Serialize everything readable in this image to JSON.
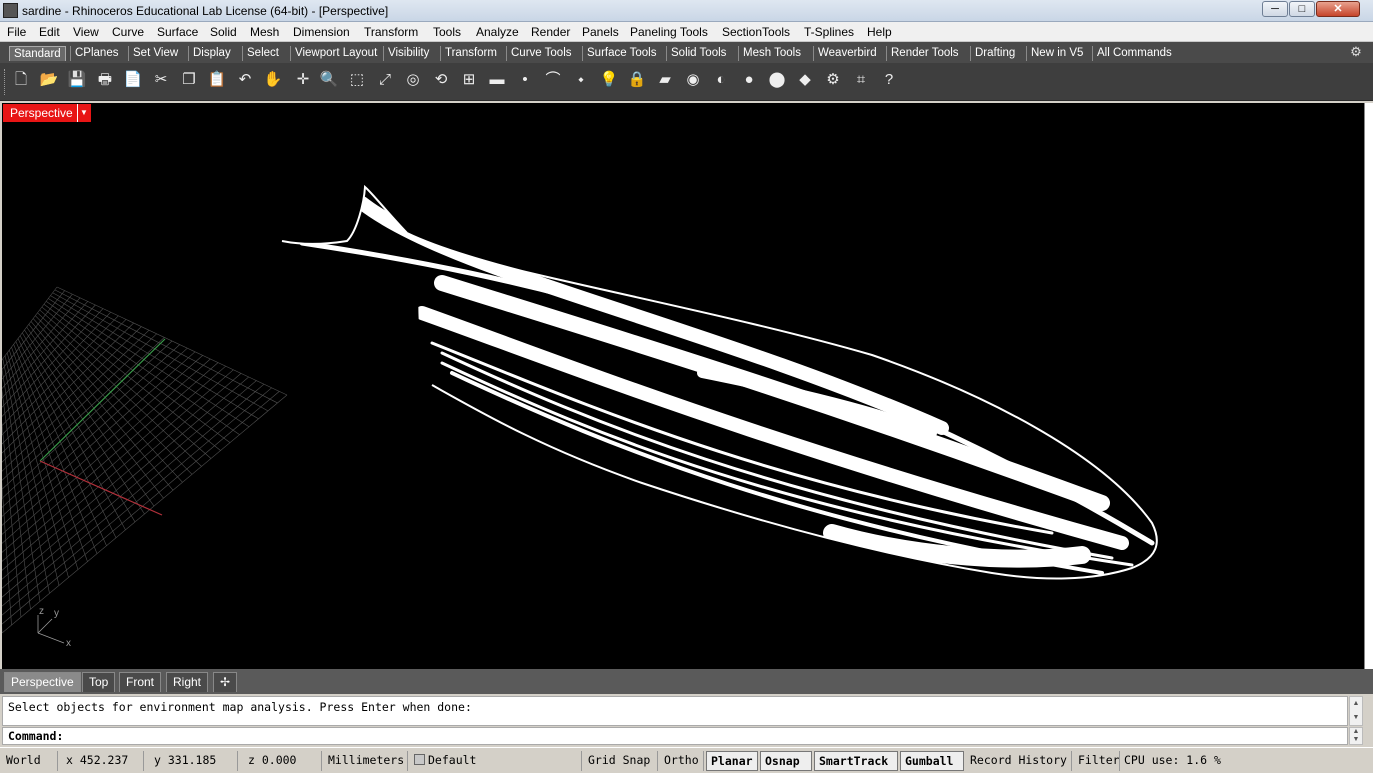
{
  "window": {
    "title": "sardine - Rhinoceros Educational Lab License (64-bit) - [Perspective]",
    "minimize": "─",
    "maximize": "□",
    "close": "✕"
  },
  "menu": [
    "File",
    "Edit",
    "View",
    "Curve",
    "Surface",
    "Solid",
    "Mesh",
    "Dimension",
    "Transform",
    "Tools",
    "Analyze",
    "Render",
    "Panels",
    "Paneling Tools",
    "SectionTools",
    "T-Splines",
    "Help"
  ],
  "toolbar_tabs": [
    "Standard",
    "CPlanes",
    "Set View",
    "Display",
    "Select",
    "Viewport Layout",
    "Visibility",
    "Transform",
    "Curve Tools",
    "Surface Tools",
    "Solid Tools",
    "Mesh Tools",
    "Weaverbird",
    "Render Tools",
    "Drafting",
    "New in V5",
    "All Commands"
  ],
  "toolbar_icons": [
    {
      "name": "new-icon",
      "glyph": "🗋"
    },
    {
      "name": "open-icon",
      "glyph": "📂"
    },
    {
      "name": "save-icon",
      "glyph": "💾"
    },
    {
      "name": "print-icon",
      "glyph": "🖶"
    },
    {
      "name": "import-icon",
      "glyph": "📄"
    },
    {
      "name": "cut-icon",
      "glyph": "✂"
    },
    {
      "name": "copy-icon",
      "glyph": "❐"
    },
    {
      "name": "paste-icon",
      "glyph": "📋"
    },
    {
      "name": "undo-icon",
      "glyph": "↶"
    },
    {
      "name": "pan-icon",
      "glyph": "✋"
    },
    {
      "name": "rotate-view-icon",
      "glyph": "✛"
    },
    {
      "name": "zoom-icon",
      "glyph": "🔍"
    },
    {
      "name": "zoom-window-icon",
      "glyph": "⬚"
    },
    {
      "name": "zoom-extents-icon",
      "glyph": "⤢"
    },
    {
      "name": "zoom-selected-icon",
      "glyph": "◎"
    },
    {
      "name": "undo-view-icon",
      "glyph": "⟲"
    },
    {
      "name": "four-viewports-icon",
      "glyph": "⊞"
    },
    {
      "name": "car-icon",
      "glyph": "▬"
    },
    {
      "name": "point-icon",
      "glyph": "•"
    },
    {
      "name": "curve-icon",
      "glyph": "⌒"
    },
    {
      "name": "select-points-icon",
      "glyph": "⬩"
    },
    {
      "name": "light-icon",
      "glyph": "💡"
    },
    {
      "name": "lock-icon",
      "glyph": "🔒"
    },
    {
      "name": "layer-icon",
      "glyph": "▰"
    },
    {
      "name": "color-wheel-icon",
      "glyph": "◉"
    },
    {
      "name": "sphere-shaded-icon",
      "glyph": "◐"
    },
    {
      "name": "sphere-render-icon",
      "glyph": "●"
    },
    {
      "name": "render-blue-icon",
      "glyph": "⬤"
    },
    {
      "name": "material-icon",
      "glyph": "◆"
    },
    {
      "name": "options-icon",
      "glyph": "⚙"
    },
    {
      "name": "bounding-icon",
      "glyph": "⌗"
    },
    {
      "name": "help-icon",
      "glyph": "?"
    }
  ],
  "viewport": {
    "label": "Perspective",
    "dropdown": "▼",
    "axis_z": "z",
    "axis_y": "y",
    "axis_x": "x"
  },
  "view_tabs": [
    "Perspective",
    "Top",
    "Front",
    "Right"
  ],
  "add_view_icon": "✢",
  "command": {
    "history": "Select objects for environment map analysis. Press Enter when done:",
    "prompt": "Command:"
  },
  "status": {
    "cplane": "World",
    "x": "x 452.237",
    "y": "y 331.185",
    "z": "z 0.000",
    "units": "Millimeters",
    "layer": "Default",
    "grid_snap": "Grid Snap",
    "ortho": "Ortho",
    "planar": "Planar",
    "osnap": "Osnap",
    "smarttrack": "SmartTrack",
    "gumball": "Gumball",
    "record_history": "Record History",
    "filter": "Filter",
    "cpu": "CPU use: 1.6 %"
  },
  "colors": {
    "viewport_bg": "#000000",
    "viewport_label": "#e81515",
    "grid": "#5a5a5a",
    "x_axis": "#b0303a",
    "y_axis": "#3a9a4a"
  }
}
